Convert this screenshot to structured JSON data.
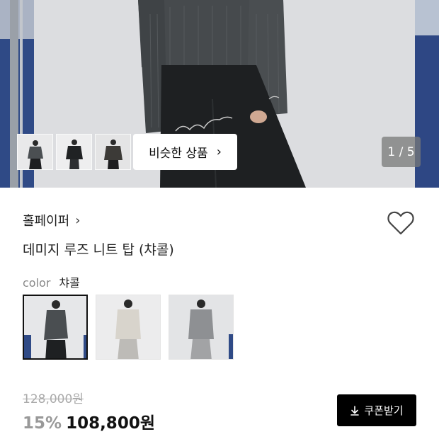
{
  "gallery": {
    "counter": "1 / 5",
    "similar_button_label": "비슷한 상품",
    "thumbnail_count": 3
  },
  "product": {
    "brand": "홀페이퍼",
    "title": "데미지 루즈 니트 탑 (챠콜)",
    "wishlist_icon": "heart-outline-icon"
  },
  "options": {
    "color_label": "color",
    "selected_color": "챠콜",
    "swatches": [
      "charcoal",
      "light-beige",
      "gray"
    ]
  },
  "pricing": {
    "original_price": "128,000원",
    "discount": "15%",
    "sale_price": "108,800원",
    "coupon_label": "쿠폰받기",
    "coupon_icon": "download-icon"
  },
  "colors": {
    "text": "#222222",
    "muted": "#888888",
    "button_bg": "#000000"
  }
}
